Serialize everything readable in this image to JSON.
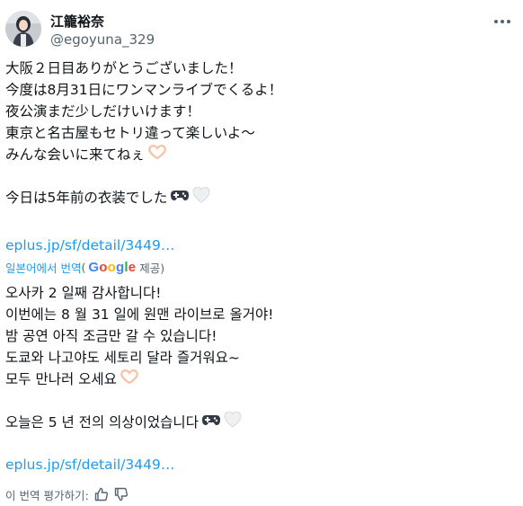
{
  "header": {
    "display_name": "江籠裕奈",
    "handle": "@egoyuna_329"
  },
  "original": {
    "lines": [
      "大阪２日目ありがとうございました！",
      "今度は8月31日にワンマンライブでくるよ！",
      "夜公演まだ少しだけいけます！",
      "東京と名古屋もセトリ違って楽しいよ〜",
      "みんな会いに来てねぇ",
      "今日は5年前の衣装でした"
    ],
    "link": "eplus.jp/sf/detail/3449…"
  },
  "translation": {
    "label": "일본어에서 번역",
    "paren_open": "(",
    "google": [
      "G",
      "o",
      "o",
      "g",
      "l",
      "e"
    ],
    "google_colors": [
      "#4285f4",
      "#ea4335",
      "#fbbc05",
      "#4285f4",
      "#34a853",
      "#ea4335"
    ],
    "provided": "제공)",
    "lines": [
      "오사카 2 일째 감사합니다!",
      "이번에는 8 월 31 일에 원맨 라이브로 올거야!",
      "밤 공연 아직 조금만 갈 수 있습니다!",
      "도쿄와 나고야도 세토리 달라 즐거워요~",
      "모두 만나러 오세요",
      "오늘은 5 년 전의 의상이었습니다"
    ],
    "link": "eplus.jp/sf/detail/3449…"
  },
  "rating": {
    "label": "이 번역 평가하기:"
  },
  "icons": [
    "heart-hands-icon",
    "game-controller-icon",
    "white-heart-icon",
    "thumbs-up-icon",
    "thumbs-down-icon",
    "more-icon"
  ],
  "colors": {
    "text": "#0f1419",
    "secondary": "#536471",
    "link": "#1d9bf0",
    "heart_hands": "#f7c4a6"
  }
}
